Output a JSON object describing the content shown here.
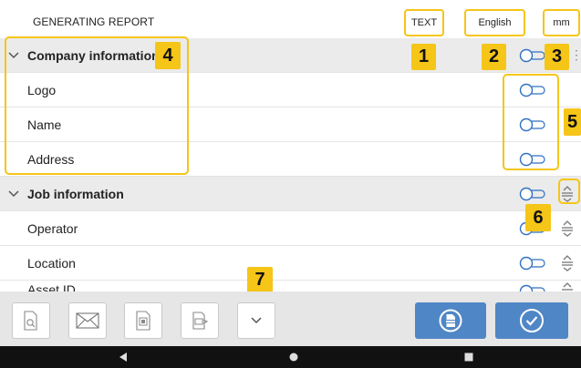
{
  "header": {
    "title": "GENERATING REPORT",
    "format_button": "TEXT",
    "language_button": "English",
    "units_button": "mm"
  },
  "sections": [
    {
      "title": "Company information",
      "items": [
        "Logo",
        "Name",
        "Address"
      ]
    },
    {
      "title": "Job information",
      "items": [
        "Operator",
        "Location",
        "Asset ID"
      ]
    }
  ],
  "badges": {
    "b1": "1",
    "b2": "2",
    "b3": "3",
    "b4": "4",
    "b5": "5",
    "b6": "6",
    "b7": "7"
  },
  "bottom_toolbar": {
    "icons": [
      "preview-icon",
      "email-icon",
      "qr-code-icon",
      "export-icon",
      "chevron-down-icon",
      "pdf-icon",
      "check-icon"
    ]
  },
  "colors": {
    "highlight": "#f5c518",
    "section_bg": "#ebebeb",
    "primary_blue": "#4f86c6",
    "toggle_blue": "#2f6fc2"
  }
}
